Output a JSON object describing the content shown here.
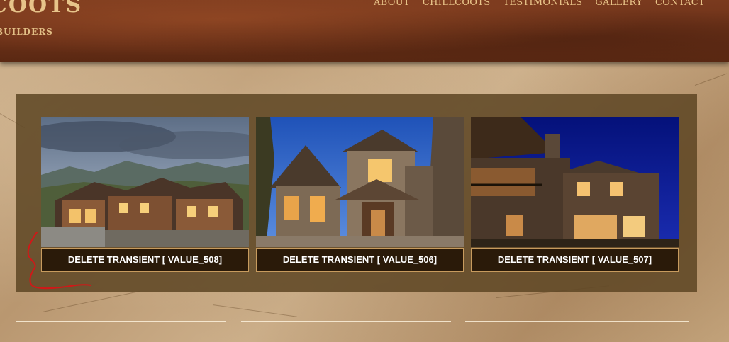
{
  "brand": {
    "name_fragment": "COOTS",
    "tagline_fragment": "BUILDERS"
  },
  "nav": {
    "items": [
      {
        "label": "ABOUT"
      },
      {
        "label": "CHILLCOOTS"
      },
      {
        "label": "TESTIMONIALS"
      },
      {
        "label": "GALLERY"
      },
      {
        "label": "CONTACT"
      }
    ]
  },
  "gallery": {
    "cards": [
      {
        "caption": "DELETE TRANSIENT [ VALUE_508]",
        "photo": "log-cabin-mountains-dusk"
      },
      {
        "caption": "DELETE TRANSIENT [ VALUE_506]",
        "photo": "timber-home-entrance-twilight"
      },
      {
        "caption": "DELETE TRANSIENT [ VALUE_507]",
        "photo": "lodge-deck-night"
      }
    ]
  },
  "colors": {
    "header_bg": "#6a3018",
    "nav_text": "#e9c58a",
    "panel_bg": "#604826",
    "caption_bg": "#2a1a09",
    "caption_border": "#c79b5e",
    "annotation": "#d01818"
  }
}
